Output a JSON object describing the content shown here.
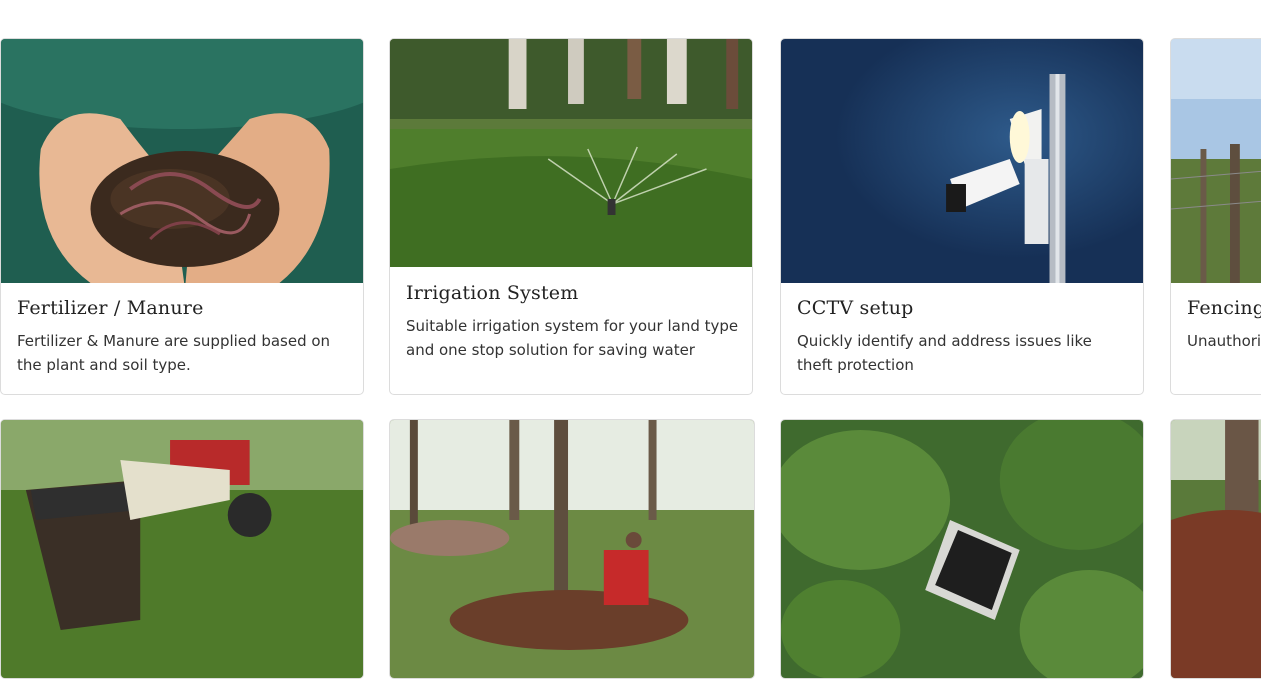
{
  "services": [
    {
      "title": "Fertilizer / Manure",
      "description": "Fertilizer & Manure are supplied based on the plant and soil type.",
      "image_subject": "hands holding soil with earthworms"
    },
    {
      "title": "Irrigation System",
      "description": "Suitable irrigation system for your land type and one stop solution for saving water",
      "image_subject": "sprinkler spraying water on grass"
    },
    {
      "title": "CCTV setup",
      "description": "Quickly identify and address issues like theft protection",
      "image_subject": "security camera and light on pole at night"
    },
    {
      "title": "Fencing",
      "description": "Unauthori... the risk of",
      "image_subject": "wire fence posts in field"
    }
  ],
  "row2_images": [
    {
      "image_subject": "tractor bucket loading soil in coconut farm"
    },
    {
      "image_subject": "tiller ploughing around coconut tree"
    },
    {
      "image_subject": "aerial view of water tank among palms"
    },
    {
      "image_subject": "soil around coconut tree trunk"
    }
  ],
  "colors": {
    "card_border": "#dcdcdc",
    "title_text": "#222222",
    "body_text": "#333333"
  }
}
